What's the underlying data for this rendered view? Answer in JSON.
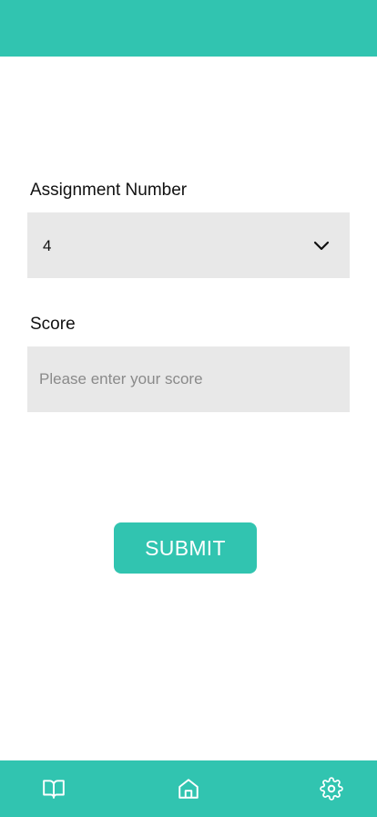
{
  "colors": {
    "accent": "#31c4b0",
    "field_background": "#e8e8e8",
    "placeholder": "#8a8a8a"
  },
  "form": {
    "assignment_label": "Assignment Number",
    "assignment_value": "4",
    "score_label": "Score",
    "score_placeholder": "Please enter your score",
    "score_value": "",
    "submit_label": "SUBMIT"
  },
  "bottom_nav": {
    "items": [
      {
        "icon": "book-icon"
      },
      {
        "icon": "home-icon"
      },
      {
        "icon": "gear-icon"
      }
    ]
  }
}
